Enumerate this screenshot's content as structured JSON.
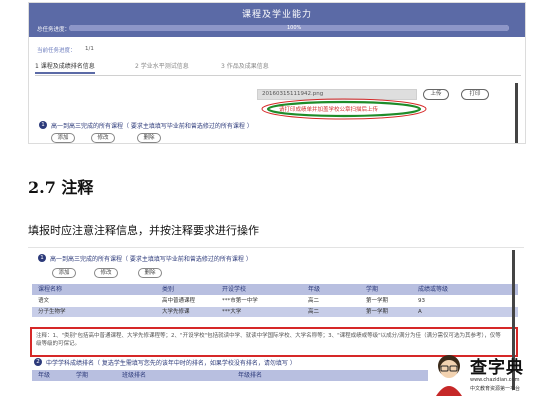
{
  "screenshot1": {
    "header_title": "课程及学业能力",
    "total_tasks_label": "总任务进度：",
    "progress_pct_label": "100%",
    "progress_value": 1.0,
    "current_tasks_label": "当前任务进度：",
    "current_tasks_value": "1/1",
    "tabs": [
      "1 课程及成绩排名信息",
      "2 学业水平测试信息",
      "3 作品及成果信息"
    ],
    "file_name": "20160315111942.png",
    "upload_label": "上传",
    "print_label": "打印",
    "warning_text": "请打印成绩单并加盖学校公章扫描后上传",
    "section_number": "1",
    "section_desc": "高一到高三完成的所有课程（ 要求主填填写毕业前和曾选修过的所有课程 ）",
    "add_label": "添加",
    "edit_label": "修改",
    "delete_label": "删除"
  },
  "section": {
    "heading": "2.7 注释",
    "paragraph": "填报时应注意注释信息，并按注释要求进行操作"
  },
  "screenshot2": {
    "section_number": "1",
    "section_desc": "高一到高三完成的所有课程（ 要求主填填写毕业前和曾选修过的所有课程 ）",
    "add_label": "添加",
    "edit_label": "修改",
    "delete_label": "删除",
    "columns": [
      "课程名称",
      "类别",
      "开设学校",
      "年级",
      "学期",
      "成绩或等级"
    ],
    "rows": [
      [
        "语文",
        "高中普通课程",
        "***市第一中学",
        "高二",
        "第一学期",
        "93"
      ],
      [
        "分子生物学",
        "大学先修课",
        "***大学",
        "高二",
        "第一学期",
        "A"
      ]
    ],
    "note_text": "注释：1、\"类别\"包括高中普通课程、大学先修课程等；2、\"开设学校\"包括就读中学、就读中学国际学校、大学名称等；3、\"课程成绩或等级\"以成分/满分为佳（满分需仅可选为其参考），仅等级等级的可保记。",
    "section2_number": "2",
    "section2_desc": "中学学科成绩排名（ 复选学生需填写您先的该年中时的排名，如果学校没有排名，请勿填写 ）",
    "sub_columns": [
      "年级",
      "学期",
      "班级排名",
      "年级排名"
    ]
  },
  "logo": {
    "name": "查字典",
    "url": "www.chazidian.com",
    "tagline": "中文教育资源第一平台"
  },
  "colors": {
    "header": "#5b6aa6",
    "accent_navy": "#2c3a7a",
    "highlight_red": "#d62828",
    "annotation_green": "#1e8c2a"
  }
}
